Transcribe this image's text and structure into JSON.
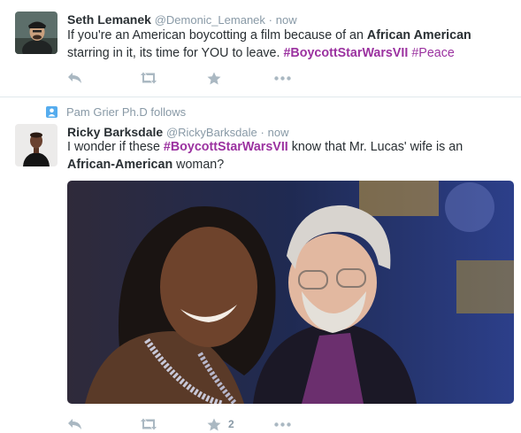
{
  "tweets": [
    {
      "name": "Seth Lemanek",
      "handle": "@Demonic_Lemanek",
      "separator": "·",
      "time": "now",
      "text_segments": [
        "If you're an American boycotting a film because of an ",
        "African American",
        " starring in it, its time for YOU to leave. ",
        "#BoycottStarWarsVII",
        " ",
        "#Peace"
      ],
      "actions": {
        "reply_icon": "reply-icon",
        "retweet_icon": "retweet-icon",
        "favorite_icon": "star-icon",
        "more_icon": "more-icon"
      }
    },
    {
      "context": "Pam Grier Ph.D follows",
      "context_icon": "person-icon",
      "name": "Ricky Barksdale",
      "handle": "@RickyBarksdale",
      "separator": "·",
      "time": "now",
      "text_segments": [
        "I wonder if these ",
        "#BoycottStarWarsVII",
        " know that Mr. Lucas' wife is an ",
        "African-American",
        " woman?"
      ],
      "media": "photo",
      "favorite_count": "2",
      "actions": {
        "reply_icon": "reply-icon",
        "retweet_icon": "retweet-icon",
        "favorite_icon": "star-icon",
        "more_icon": "more-icon"
      }
    }
  ],
  "colors": {
    "hashtag": "#9b32a0",
    "meta": "#8899a6",
    "icon": "#aab8c2",
    "text": "#292f33",
    "divider": "#e1e8ed",
    "follows_icon": "#55acee"
  }
}
